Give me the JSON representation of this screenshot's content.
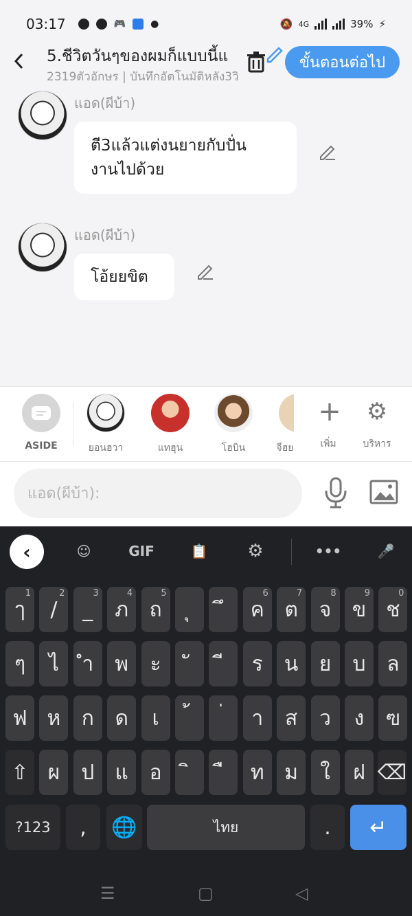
{
  "status_bar": {
    "time": "03:17",
    "network": "4G",
    "battery": "39%"
  },
  "header": {
    "title": "5.ชีวิตวันๆของผมก็แบบนี้แ",
    "subtitle": "2319ตัวอักษร | บันทึกอัตโนมัติหลัง3วิ",
    "next_label": "ขั้นตอนต่อไป"
  },
  "messages": [
    {
      "sender": "แอด(ผีบ้า)",
      "text_line1": "ตี3แล้วแต่งนยายกับปั่น",
      "text_line2": "งานไปด้วย"
    },
    {
      "sender": "แอด(ผีบ้า)",
      "text_line1": "โอ้ยยขิต"
    }
  ],
  "characters": {
    "aside": "ASIDE",
    "items": [
      "ยอนฮวา",
      "แทฮุน",
      "โฮบิน",
      "จีฮย"
    ],
    "add": "เพิ่ม",
    "manage": "บริหาร"
  },
  "input": {
    "placeholder": "แอด(ผีบ้า):"
  },
  "keyboard": {
    "toolbar": {
      "gif": "GIF"
    },
    "row1": [
      [
        "ๅ",
        "1"
      ],
      [
        "/",
        "2"
      ],
      [
        "_",
        "3"
      ],
      [
        "ภ",
        "4"
      ],
      [
        "ถ",
        "5"
      ],
      [
        "ุ",
        ""
      ],
      [
        "ึ",
        ""
      ],
      [
        "ค",
        "6"
      ],
      [
        "ต",
        "7"
      ],
      [
        "จ",
        "8"
      ],
      [
        "ข",
        "9"
      ],
      [
        "ช",
        "0"
      ]
    ],
    "row2": [
      "ๆ",
      "ไ",
      "ำ",
      "พ",
      "ะ",
      "ั",
      "ี",
      "ร",
      "น",
      "ย",
      "บ",
      "ล"
    ],
    "row3": [
      "ฟ",
      "ห",
      "ก",
      "ด",
      "เ",
      "้",
      "่",
      "า",
      "ส",
      "ว",
      "ง",
      "ฃ"
    ],
    "row4": [
      "ผ",
      "ป",
      "แ",
      "อ",
      "ิ",
      "ื",
      "ท",
      "ม",
      "ใ",
      "ฝ"
    ],
    "sym": "?123",
    "comma": ",",
    "space": "ไทย",
    "period": "."
  },
  "colors": {
    "accent": "#4a9bf0",
    "keyboard_bg": "#202124",
    "key_bg": "#3c3c3f",
    "enter": "#4a8fe8"
  }
}
